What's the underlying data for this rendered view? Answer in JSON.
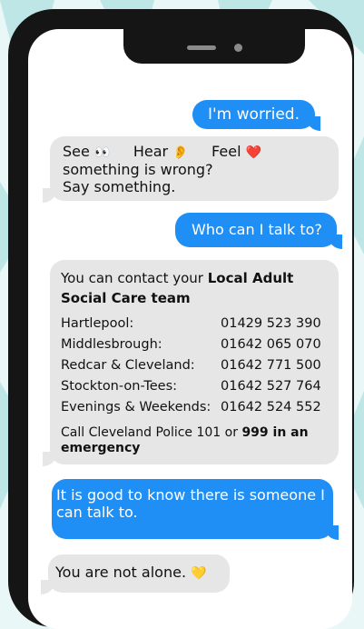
{
  "messages": {
    "m1": {
      "text": "I'm worried."
    },
    "m2": {
      "see": "See",
      "see_emoji": "👀",
      "hear": "Hear",
      "hear_emoji": "👂",
      "feel": "Feel",
      "feel_emoji": "❤️",
      "line2": "something is wrong?",
      "line3": "Say something."
    },
    "m3": {
      "text": "Who can I talk to?"
    },
    "m4": {
      "intro": "You can contact your",
      "intro_bold": "Local Adult Social Care team",
      "contacts": [
        {
          "place": "Hartlepool:",
          "phone": "01429 523 390"
        },
        {
          "place": "Middlesbrough:",
          "phone": "01642 065 070"
        },
        {
          "place": "Redcar & Cleveland:",
          "phone": "01642 771 500"
        },
        {
          "place": "Stockton-on-Tees:",
          "phone": "01642 527 764"
        },
        {
          "place": "Evenings & Weekends:",
          "phone": "01642 524 552"
        }
      ],
      "police": "Call Cleveland Police 101 or",
      "police_bold": "999 in an emergency"
    },
    "m5": {
      "text": "It is good to know there is someone I can talk to."
    },
    "m6": {
      "text": "You are not alone.",
      "emoji": "💛"
    }
  },
  "colors": {
    "outgoing": "#1f8ef5",
    "incoming": "#e6e6e6",
    "background": "#eaf7f7",
    "rays": "#bfe6e6"
  }
}
